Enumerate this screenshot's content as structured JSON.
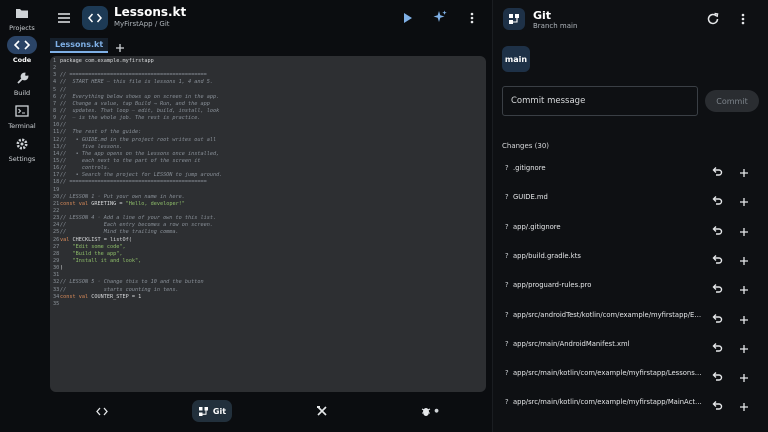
{
  "rail": {
    "items": [
      {
        "label": "Projects",
        "icon": "folder-icon"
      },
      {
        "label": "Code",
        "icon": "code-icon"
      },
      {
        "label": "Build",
        "icon": "wrench-icon"
      },
      {
        "label": "Terminal",
        "icon": "terminal-icon"
      },
      {
        "label": "Settings",
        "icon": "gear-icon"
      }
    ],
    "active": "Code"
  },
  "editor": {
    "file_title": "Lessons.kt",
    "file_subtitle": "MyFirstApp / Git",
    "tab_label": "Lessons.kt",
    "lines": [
      {
        "n": "1",
        "t": "package com.example.myfirstapp",
        "k": "p"
      },
      {
        "n": "2",
        "t": "",
        "k": "p"
      },
      {
        "n": "3",
        "t": "// ============================================",
        "k": "c"
      },
      {
        "n": "4",
        "t": "//  START HERE — this file is lessons 1, 4 and 5.",
        "k": "c"
      },
      {
        "n": "5",
        "t": "//",
        "k": "c"
      },
      {
        "n": "6",
        "t": "//  Everything below shows up on screen in the app.",
        "k": "c"
      },
      {
        "n": "7",
        "t": "//  Change a value, tap Build → Run, and the app",
        "k": "c"
      },
      {
        "n": "8",
        "t": "//  updates. That loop — edit, build, install, look",
        "k": "c"
      },
      {
        "n": "9",
        "t": "//  — is the whole job. The rest is practice.",
        "k": "c"
      },
      {
        "n": "10",
        "t": "//",
        "k": "c"
      },
      {
        "n": "11",
        "t": "//  The rest of the guide:",
        "k": "c"
      },
      {
        "n": "12",
        "t": "//   • GUIDE.md in the project root writes out all",
        "k": "c"
      },
      {
        "n": "13",
        "t": "//     five lessons.",
        "k": "c"
      },
      {
        "n": "14",
        "t": "//   • The app opens on the Lessons once installed,",
        "k": "c"
      },
      {
        "n": "15",
        "t": "//     each next to the part of the screen it",
        "k": "c"
      },
      {
        "n": "16",
        "t": "//     controls.",
        "k": "c"
      },
      {
        "n": "17",
        "t": "//   • Search the project for LESSON to jump around.",
        "k": "c"
      },
      {
        "n": "18",
        "t": "// ============================================",
        "k": "c"
      },
      {
        "n": "19",
        "t": "",
        "k": "p"
      },
      {
        "n": "20",
        "t": "// LESSON 1 · Put your own name in here.",
        "k": "c"
      },
      {
        "n": "21",
        "t": "const val GREETING = \"Hello, developer!\"",
        "k": "kv"
      },
      {
        "n": "22",
        "t": "",
        "k": "p"
      },
      {
        "n": "23",
        "t": "// LESSON 4 · Add a line of your own to this list.",
        "k": "c"
      },
      {
        "n": "24",
        "t": "//            Each entry becomes a row on screen.",
        "k": "c"
      },
      {
        "n": "25",
        "t": "//            Mind the trailing comma.",
        "k": "c"
      },
      {
        "n": "26",
        "t": "val CHECKLIST = listOf(",
        "k": "kv"
      },
      {
        "n": "27",
        "t": "    \"Edit some code\",",
        "k": "s"
      },
      {
        "n": "28",
        "t": "    \"Build the app\",",
        "k": "s"
      },
      {
        "n": "29",
        "t": "    \"Install it and look\",",
        "k": "s"
      },
      {
        "n": "30",
        "t": ")",
        "k": "p"
      },
      {
        "n": "31",
        "t": "",
        "k": "p"
      },
      {
        "n": "32",
        "t": "// LESSON 5 · Change this to 10 and the button",
        "k": "c"
      },
      {
        "n": "33",
        "t": "//            starts counting in tens.",
        "k": "c"
      },
      {
        "n": "34",
        "t": "const val COUNTER_STEP = 1",
        "k": "kv"
      },
      {
        "n": "35",
        "t": "",
        "k": "p"
      }
    ]
  },
  "bottom_nav": {
    "items": [
      {
        "label": "",
        "icon": "code-icon"
      },
      {
        "label": "Git",
        "icon": "git-icon"
      },
      {
        "label": "",
        "icon": "tools-icon"
      },
      {
        "label": "",
        "icon": "bug-icon"
      }
    ],
    "active": "Git"
  },
  "git": {
    "title": "Git",
    "branch_line": "Branch main",
    "branch_chip": "main",
    "commit_placeholder": "Commit message",
    "commit_button": "Commit",
    "changes_header": "Changes (30)",
    "changes": [
      {
        "status": "?",
        "path": ".gitignore"
      },
      {
        "status": "?",
        "path": "GUIDE.md"
      },
      {
        "status": "?",
        "path": "app/.gitignore"
      },
      {
        "status": "?",
        "path": "app/build.gradle.kts"
      },
      {
        "status": "?",
        "path": "app/proguard-rules.pro"
      },
      {
        "status": "?",
        "path": "app/src/androidTest/kotlin/com/example/myfirstapp/ExampleInstrumentedTest.kt"
      },
      {
        "status": "?",
        "path": "app/src/main/AndroidManifest.xml"
      },
      {
        "status": "?",
        "path": "app/src/main/kotlin/com/example/myfirstapp/Lessons.kt"
      },
      {
        "status": "?",
        "path": "app/src/main/kotlin/com/example/myfirstapp/MainActivity.kt"
      }
    ]
  },
  "colors": {
    "accent": "#7fb0e6",
    "badge_bg": "#1d3a55",
    "code_bg": "#2d2f32"
  }
}
